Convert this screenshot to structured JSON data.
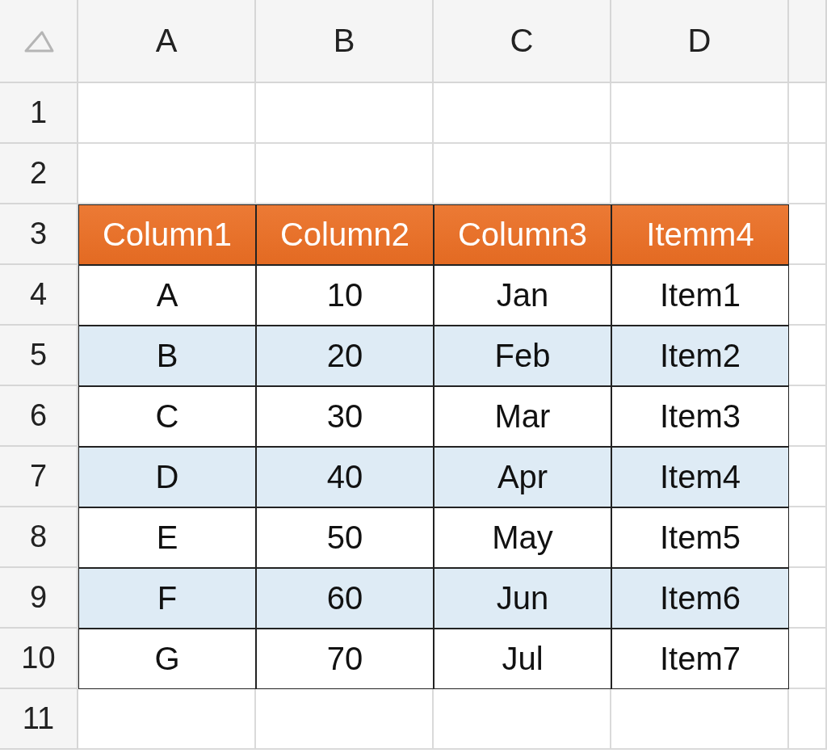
{
  "column_headers": [
    "A",
    "B",
    "C",
    "D"
  ],
  "row_numbers": [
    "1",
    "2",
    "3",
    "4",
    "5",
    "6",
    "7",
    "8",
    "9",
    "10",
    "11"
  ],
  "table": {
    "header": [
      "Column1",
      "Column2",
      "Column3",
      "Itemm4"
    ],
    "rows": [
      {
        "banded": false,
        "cells": [
          "A",
          "10",
          "Jan",
          "Item1"
        ]
      },
      {
        "banded": true,
        "cells": [
          "B",
          "20",
          "Feb",
          "Item2"
        ]
      },
      {
        "banded": false,
        "cells": [
          "C",
          "30",
          "Mar",
          "Item3"
        ]
      },
      {
        "banded": true,
        "cells": [
          "D",
          "40",
          "Apr",
          "Item4"
        ]
      },
      {
        "banded": false,
        "cells": [
          "E",
          "50",
          "May",
          "Item5"
        ]
      },
      {
        "banded": true,
        "cells": [
          "F",
          "60",
          "Jun",
          "Item6"
        ]
      },
      {
        "banded": false,
        "cells": [
          "G",
          "70",
          "Jul",
          "Item7"
        ]
      }
    ]
  }
}
